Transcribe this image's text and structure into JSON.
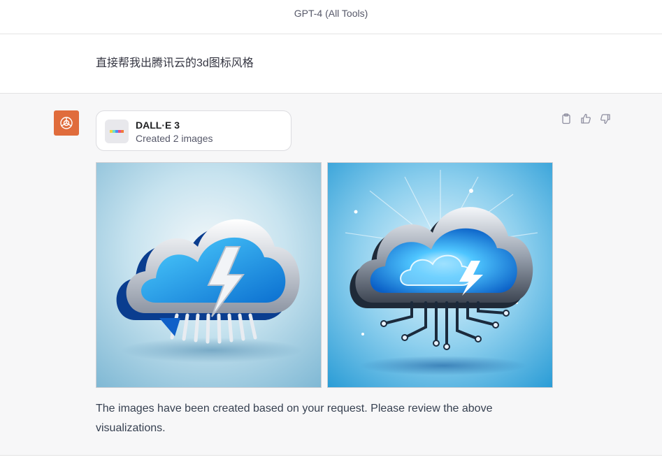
{
  "header": {
    "title": "GPT-4 (All Tools)"
  },
  "user_message": {
    "text": "直接帮我出腾讯云的3d图标风格"
  },
  "assistant_message": {
    "avatar_icon": "openai-logo-icon",
    "avatar_color": "#e06c3c",
    "tool_card": {
      "icon": "dalle-palette-icon",
      "name": "DALL·E 3",
      "subtitle": "Created 2 images"
    },
    "actions": [
      {
        "icon": "clipboard-icon"
      },
      {
        "icon": "thumbs-up-icon"
      },
      {
        "icon": "thumbs-down-icon"
      }
    ],
    "images": [
      {
        "icon": "cloud-lightning-icon"
      },
      {
        "icon": "cloud-circuit-icon"
      }
    ],
    "response_text": "The images have been created based on your request. Please review the above visualizations."
  },
  "colors": {
    "accent_blue": "#1a8fd8",
    "background_assistant": "#f7f7f8"
  }
}
